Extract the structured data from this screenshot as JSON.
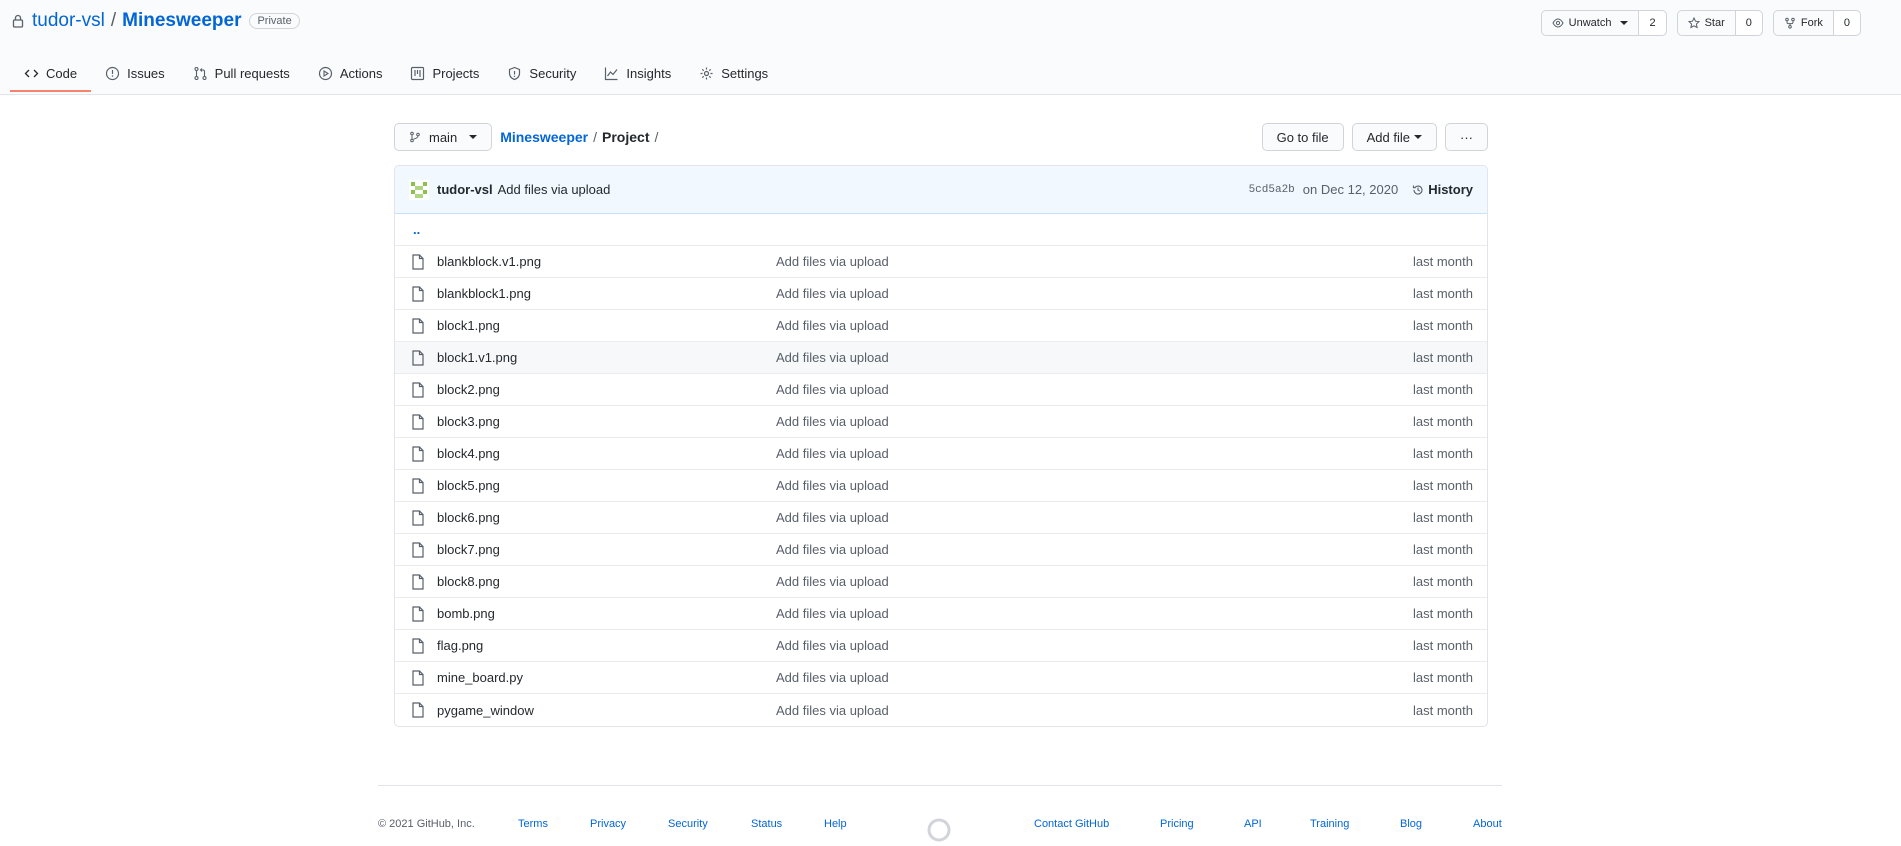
{
  "repo": {
    "owner": "tudor-vsl",
    "separator": "/",
    "name": "Minesweeper",
    "visibility": "Private"
  },
  "repo_actions": {
    "watch": {
      "label": "Unwatch",
      "count": "2"
    },
    "star": {
      "label": "Star",
      "count": "0"
    },
    "fork": {
      "label": "Fork",
      "count": "0"
    }
  },
  "tabs": [
    {
      "label": "Code",
      "icon": "code-icon",
      "active": true
    },
    {
      "label": "Issues",
      "icon": "issue-icon"
    },
    {
      "label": "Pull requests",
      "icon": "pull-request-icon"
    },
    {
      "label": "Actions",
      "icon": "play-icon"
    },
    {
      "label": "Projects",
      "icon": "project-icon"
    },
    {
      "label": "Security",
      "icon": "shield-icon"
    },
    {
      "label": "Insights",
      "icon": "graph-icon"
    },
    {
      "label": "Settings",
      "icon": "gear-icon"
    }
  ],
  "file_nav": {
    "branch": "main",
    "breadcrumb_root": "Minesweeper",
    "breadcrumb_current": "Project",
    "sep": "/",
    "go_to_file": "Go to file",
    "add_file": "Add file",
    "more": "···"
  },
  "commit": {
    "author": "tudor-vsl",
    "message": "Add files via upload",
    "sha": "5cd5a2b",
    "date": "on Dec 12, 2020",
    "history_label": "History"
  },
  "parent_dir": "..",
  "files": [
    {
      "name": "blankblock.v1.png",
      "message": "Add files via upload",
      "age": "last month"
    },
    {
      "name": "blankblock1.png",
      "message": "Add files via upload",
      "age": "last month"
    },
    {
      "name": "block1.png",
      "message": "Add files via upload",
      "age": "last month"
    },
    {
      "name": "block1.v1.png",
      "message": "Add files via upload",
      "age": "last month",
      "highlight": true
    },
    {
      "name": "block2.png",
      "message": "Add files via upload",
      "age": "last month"
    },
    {
      "name": "block3.png",
      "message": "Add files via upload",
      "age": "last month"
    },
    {
      "name": "block4.png",
      "message": "Add files via upload",
      "age": "last month"
    },
    {
      "name": "block5.png",
      "message": "Add files via upload",
      "age": "last month"
    },
    {
      "name": "block6.png",
      "message": "Add files via upload",
      "age": "last month"
    },
    {
      "name": "block7.png",
      "message": "Add files via upload",
      "age": "last month"
    },
    {
      "name": "block8.png",
      "message": "Add files via upload",
      "age": "last month"
    },
    {
      "name": "bomb.png",
      "message": "Add files via upload",
      "age": "last month"
    },
    {
      "name": "flag.png",
      "message": "Add files via upload",
      "age": "last month"
    },
    {
      "name": "mine_board.py",
      "message": "Add files via upload",
      "age": "last month"
    },
    {
      "name": "pygame_window",
      "message": "Add files via upload",
      "age": "last month"
    }
  ],
  "footer": {
    "copyright": "© 2021 GitHub, Inc.",
    "left_links": [
      "Terms",
      "Privacy",
      "Security",
      "Status",
      "Help"
    ],
    "right_links": [
      "Contact GitHub",
      "Pricing",
      "API",
      "Training",
      "Blog",
      "About"
    ]
  },
  "colors": {
    "link": "#0366d6",
    "active_tab_underline": "#f9826c",
    "commit_bar_bg": "#f1f8ff"
  }
}
